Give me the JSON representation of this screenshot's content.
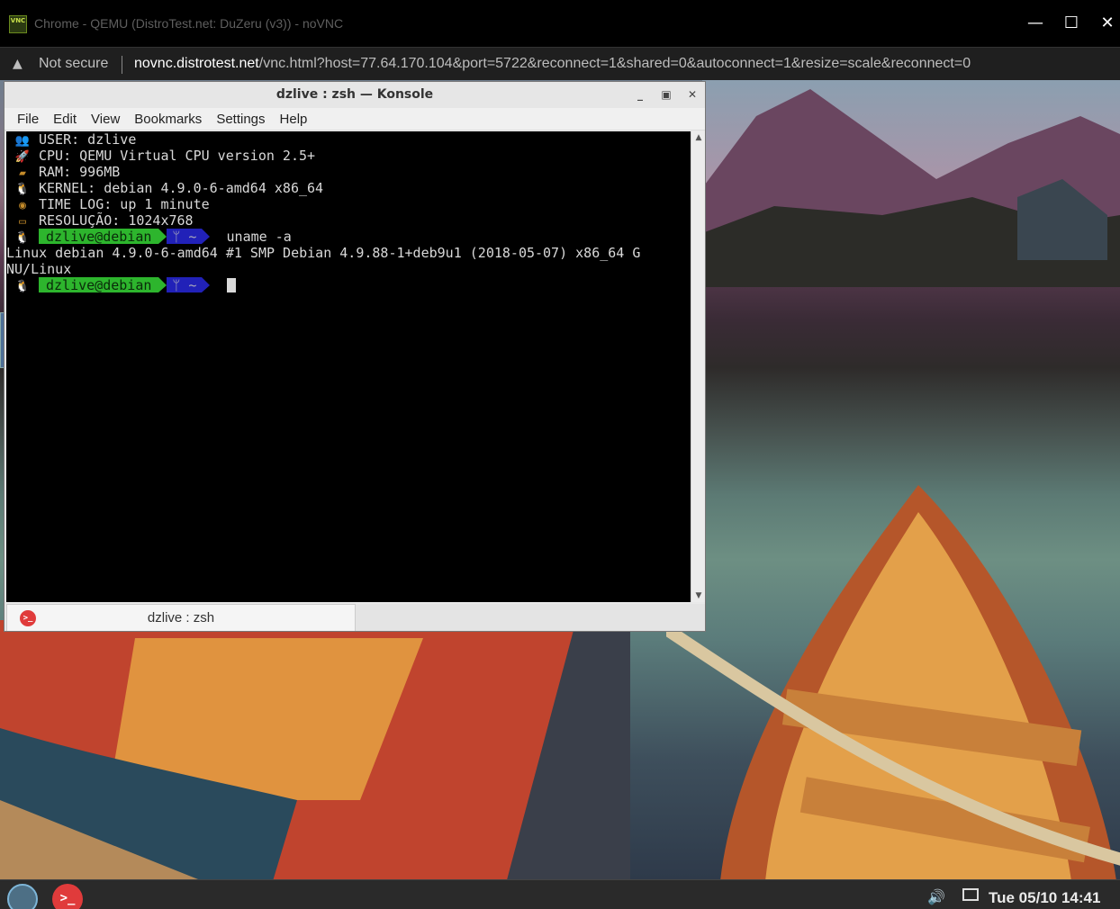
{
  "chrome": {
    "window_title": "Chrome - QEMU (DistroTest.net: DuZeru (v3)) - noVNC",
    "app_icon_text": "VNC",
    "minimize_glyph": "—",
    "maximize_glyph": "☐",
    "close_glyph": "✕",
    "security_label": "Not secure",
    "url_host": "novnc.distrotest.net",
    "url_path": "/vnc.html?host=77.64.170.104&port=5722&reconnect=1&shared=0&autoconnect=1&resize=scale&reconnect=0"
  },
  "konsole": {
    "title": "dzlive : zsh — Konsole",
    "menu": [
      "File",
      "Edit",
      "View",
      "Bookmarks",
      "Settings",
      "Help"
    ],
    "info_lines": [
      {
        "icon": "user-icon",
        "glyph": "👥",
        "text": "USER: dzlive"
      },
      {
        "icon": "rocket-icon",
        "glyph": "🚀",
        "text": "CPU: QEMU Virtual CPU version 2.5+"
      },
      {
        "icon": "memory-icon",
        "glyph": "▰",
        "text": "RAM: 996MB"
      },
      {
        "icon": "tux-icon",
        "glyph": "🐧",
        "text": "KERNEL: debian 4.9.0-6-amd64 x86_64"
      },
      {
        "icon": "clock-icon",
        "glyph": "◉",
        "text": "TIME LOG: up 1 minute"
      },
      {
        "icon": "monitor-icon",
        "glyph": "▭",
        "text": "RESOLUÇÃO: 1024x768"
      }
    ],
    "prompt_user": "dzlive@debian",
    "prompt_dir": "ᛘ ~",
    "command": "uname -a",
    "output_line_1": "Linux debian 4.9.0-6-amd64 #1 SMP Debian 4.9.88-1+deb9u1 (2018-05-07) x86_64 G",
    "output_line_2": "NU/Linux",
    "tab_label": "dzlive : zsh",
    "tab_icon_text": ">_"
  },
  "taskbar": {
    "terminal_icon_text": ">_",
    "volume_glyph": "🔊",
    "clock": "Tue 05/10 14:41"
  }
}
